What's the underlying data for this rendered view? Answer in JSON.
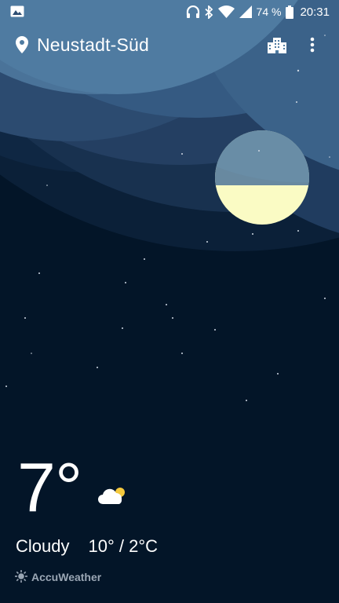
{
  "status_bar": {
    "battery_percent": "74 %",
    "time": "20:31",
    "icons": [
      "image-icon",
      "headphones-icon",
      "bluetooth-icon",
      "wifi-icon",
      "cellular-signal-icon",
      "battery-icon"
    ]
  },
  "header": {
    "location": "Neustadt-Süd",
    "location_icon": "location-pin-icon",
    "city_icon": "city-buildings-icon",
    "menu_icon": "more-vert-icon"
  },
  "weather": {
    "temperature": "7°",
    "condition": "Cloudy",
    "high_low": "10° / 2°C",
    "condition_icon": "cloudy-night-icon"
  },
  "provider": {
    "name": "AccuWeather",
    "icon": "accuweather-sun-icon"
  },
  "colors": {
    "sky_dark": "#031528",
    "band_1": "#1a3353",
    "band_2": "#2b4b70",
    "band_3": "#4f7ba1",
    "moon": "#fafbc4",
    "provider_text": "#9aa6b4"
  }
}
